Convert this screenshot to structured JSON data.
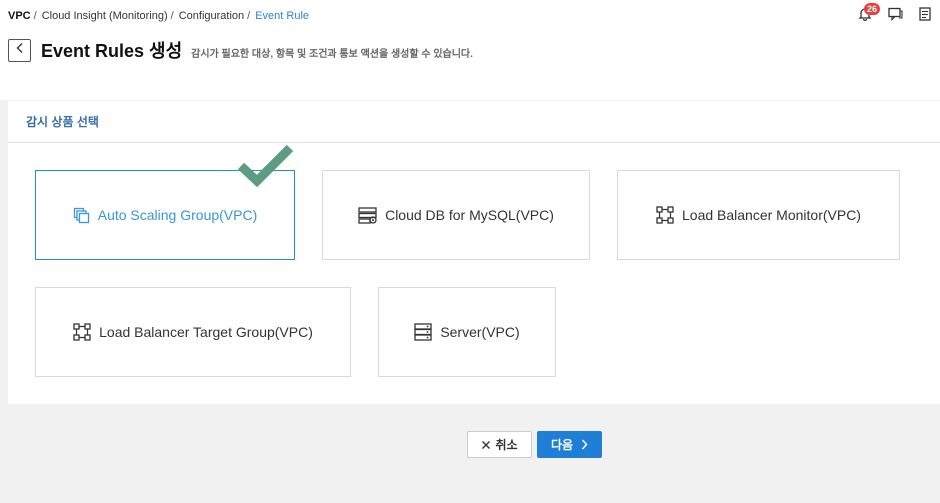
{
  "breadcrumb": {
    "items": [
      "VPC",
      "Cloud Insight (Monitoring)",
      "Configuration",
      "Event Rule"
    ],
    "separator": "/"
  },
  "top_icons": {
    "notification_count": "26",
    "icons": [
      "bell-icon",
      "chat-icon",
      "memo-icon"
    ]
  },
  "header": {
    "title": "Event Rules 생성",
    "description": "감시가 필요한 대상, 항목 및 조건과 통보 액션을 생성할 수 있습니다."
  },
  "panel": {
    "title": "감시 상품 선택"
  },
  "products": [
    {
      "label": "Auto Scaling Group(VPC)",
      "icon": "copy-stack-icon",
      "selected": true
    },
    {
      "label": "Cloud DB for MySQL(VPC)",
      "icon": "database-icon",
      "selected": false
    },
    {
      "label": "Load Balancer Monitor(VPC)",
      "icon": "network-nodes-icon",
      "selected": false
    },
    {
      "label": "Load Balancer Target Group(VPC)",
      "icon": "network-nodes-icon",
      "selected": false
    },
    {
      "label": "Server(VPC)",
      "icon": "server-icon",
      "selected": false
    }
  ],
  "actions": {
    "cancel_label": "취소",
    "next_label": "다음"
  },
  "colors": {
    "accent": "#2b86d4",
    "primary_button": "#1f7fd6",
    "check": "#5c9c80",
    "badge": "#e64040",
    "panel_title": "#3b6ea8"
  }
}
